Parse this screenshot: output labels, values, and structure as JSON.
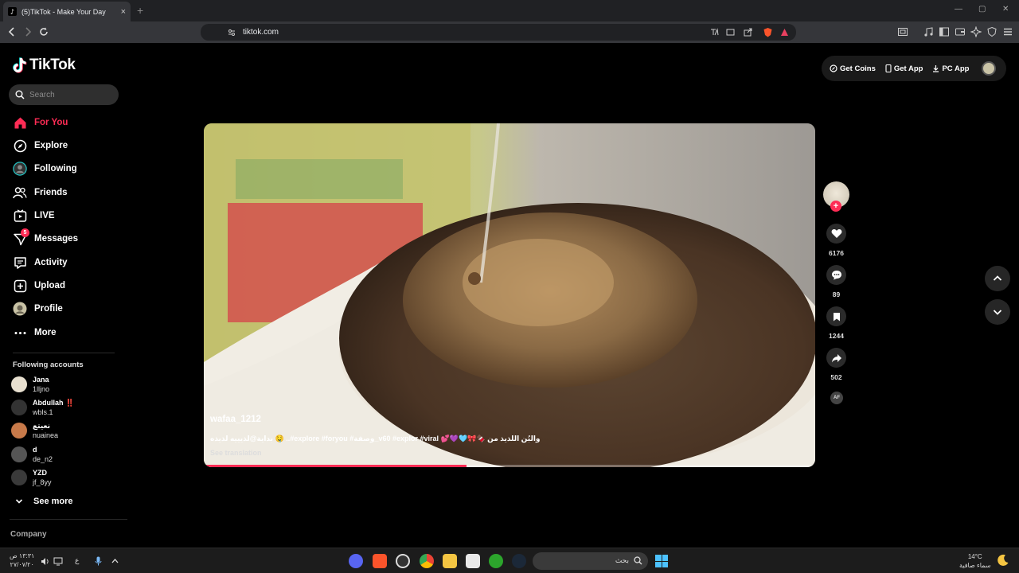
{
  "browser": {
    "tab_title": "(5)TikTok - Make Your Day",
    "tab_close": "×",
    "new_tab": "+",
    "url": "tiktok.com",
    "win_min": "—",
    "win_max": "▢",
    "win_close": "✕"
  },
  "brand": {
    "name": "TikTok"
  },
  "search": {
    "placeholder": "Search"
  },
  "nav": [
    {
      "label": "For You",
      "icon": "home-icon",
      "active": true
    },
    {
      "label": "Explore",
      "icon": "compass-icon"
    },
    {
      "label": "Following",
      "icon": "following-avatar-icon"
    },
    {
      "label": "Friends",
      "icon": "friends-icon"
    },
    {
      "label": "LIVE",
      "icon": "live-icon"
    },
    {
      "label": "Messages",
      "icon": "messages-icon",
      "badge": "5"
    },
    {
      "label": "Activity",
      "icon": "activity-icon"
    },
    {
      "label": "Upload",
      "icon": "upload-icon"
    },
    {
      "label": "Profile",
      "icon": "profile-avatar-icon"
    },
    {
      "label": "More",
      "icon": "more-icon"
    }
  ],
  "following_accounts": {
    "title": "Following accounts",
    "accounts": [
      {
        "name": "Jana",
        "handle": "1lljno"
      },
      {
        "name": "Abdullah ‼️",
        "handle": "wbls.1"
      },
      {
        "name": "نعيتع",
        "handle": "nuainea"
      },
      {
        "name": "d",
        "handle": "de_n2"
      },
      {
        "name": "YZD",
        "handle": "jf_8yy"
      }
    ],
    "see_more": "See more"
  },
  "footer": {
    "company": "Company"
  },
  "header_actions": {
    "get_coins": "Get Coins",
    "get_app": "Get App",
    "pc_app": "PC App"
  },
  "video": {
    "author": "wafaa_1212",
    "caption": "بداية@لذيييه لذيذه 🤤 ..#explore #foryou #وصفة_v60 #explor #viral 💕💜🩵🎀🍫 والبُن اللذيذ من",
    "see_translation": "See translation",
    "progress": 0.43
  },
  "actions": {
    "likes": "6176",
    "comments": "89",
    "saves": "1244",
    "shares": "502",
    "music_disc_label": "AF",
    "follow_plus": "+"
  },
  "taskbar": {
    "search_text": "بحث",
    "clock_time": "١٣:٣١ ص",
    "clock_date": "٢٧/٠٧/٢٠",
    "temperature": "14°C",
    "weather": "سماء صافية",
    "lang": "ع"
  },
  "colors": {
    "accent": "#fe2c55",
    "background": "#000000",
    "browser_bar": "#35363a"
  }
}
